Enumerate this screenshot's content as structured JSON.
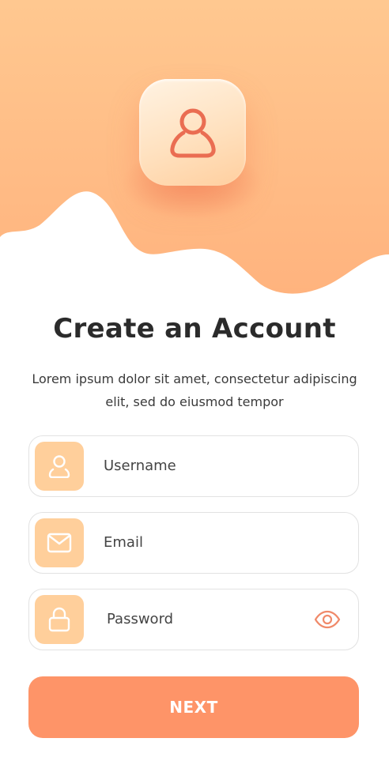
{
  "header": {
    "avatar_icon": "user-icon"
  },
  "title": "Create an Account",
  "subtitle": "Lorem ipsum dolor sit amet, consectetur adipiscing elit, sed do eiusmod tempor",
  "form": {
    "username": {
      "placeholder": "Username",
      "value": "",
      "icon": "user-icon"
    },
    "email": {
      "placeholder": "Email",
      "value": "",
      "icon": "envelope-icon"
    },
    "password": {
      "placeholder": "Password",
      "value": "",
      "icon": "lock-icon",
      "toggle_icon": "eye-icon"
    }
  },
  "next_button": {
    "label": "NEXT"
  },
  "colors": {
    "accent": "#fe9468",
    "icon_tile": "#ffcf9b",
    "hero_top": "#ffc890",
    "hero_bottom": "#ffb37e",
    "icon_stroke": "#ea6d52",
    "title_text": "#2b2b2b"
  }
}
